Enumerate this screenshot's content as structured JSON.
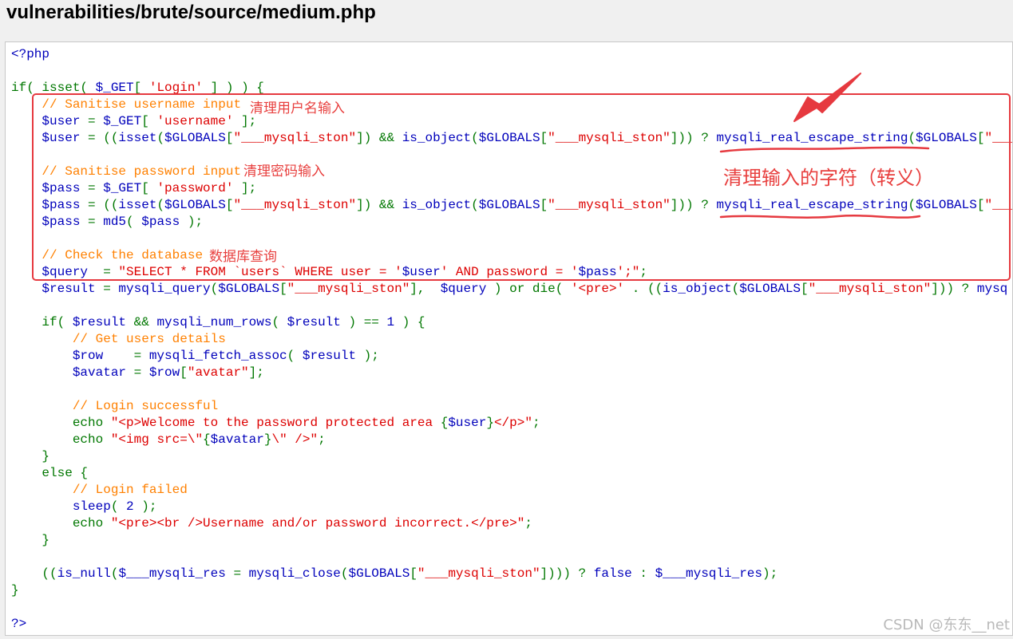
{
  "page": {
    "title": "vulnerabilities/brute/source/medium.php"
  },
  "code_lines": [
    [
      {
        "t": "<?php",
        "c": "v"
      }
    ],
    [],
    [
      {
        "t": "if( ",
        "c": "k"
      },
      {
        "t": "isset",
        "c": "k"
      },
      {
        "t": "( ",
        "c": "k"
      },
      {
        "t": "$_GET",
        "c": "v"
      },
      {
        "t": "[ ",
        "c": "k"
      },
      {
        "t": "'Login'",
        "c": "s"
      },
      {
        "t": " ] ) ) {",
        "c": "k"
      }
    ],
    [
      {
        "t": "    "
      },
      {
        "t": "// Sanitise username input",
        "c": "c"
      }
    ],
    [
      {
        "t": "    "
      },
      {
        "t": "$user ",
        "c": "v"
      },
      {
        "t": "= ",
        "c": "k"
      },
      {
        "t": "$_GET",
        "c": "v"
      },
      {
        "t": "[ ",
        "c": "k"
      },
      {
        "t": "'username'",
        "c": "s"
      },
      {
        "t": " ];",
        "c": "k"
      }
    ],
    [
      {
        "t": "    "
      },
      {
        "t": "$user ",
        "c": "v"
      },
      {
        "t": "= ((",
        "c": "k"
      },
      {
        "t": "isset",
        "c": "v"
      },
      {
        "t": "(",
        "c": "k"
      },
      {
        "t": "$GLOBALS",
        "c": "v"
      },
      {
        "t": "[",
        "c": "k"
      },
      {
        "t": "\"___mysqli_ston\"",
        "c": "s"
      },
      {
        "t": "]) && ",
        "c": "k"
      },
      {
        "t": "is_object",
        "c": "v"
      },
      {
        "t": "(",
        "c": "k"
      },
      {
        "t": "$GLOBALS",
        "c": "v"
      },
      {
        "t": "[",
        "c": "k"
      },
      {
        "t": "\"___mysqli_ston\"",
        "c": "s"
      },
      {
        "t": "])) ? ",
        "c": "k"
      },
      {
        "t": "mysqli_real_escape_string",
        "c": "v"
      },
      {
        "t": "(",
        "c": "k"
      },
      {
        "t": "$GLOBALS",
        "c": "v"
      },
      {
        "t": "[",
        "c": "k"
      },
      {
        "t": "\"___mysqli_ston\"",
        "c": "s"
      }
    ],
    [],
    [
      {
        "t": "    "
      },
      {
        "t": "// Sanitise password input",
        "c": "c"
      }
    ],
    [
      {
        "t": "    "
      },
      {
        "t": "$pass ",
        "c": "v"
      },
      {
        "t": "= ",
        "c": "k"
      },
      {
        "t": "$_GET",
        "c": "v"
      },
      {
        "t": "[ ",
        "c": "k"
      },
      {
        "t": "'password'",
        "c": "s"
      },
      {
        "t": " ];",
        "c": "k"
      }
    ],
    [
      {
        "t": "    "
      },
      {
        "t": "$pass ",
        "c": "v"
      },
      {
        "t": "= ((",
        "c": "k"
      },
      {
        "t": "isset",
        "c": "v"
      },
      {
        "t": "(",
        "c": "k"
      },
      {
        "t": "$GLOBALS",
        "c": "v"
      },
      {
        "t": "[",
        "c": "k"
      },
      {
        "t": "\"___mysqli_ston\"",
        "c": "s"
      },
      {
        "t": "]) && ",
        "c": "k"
      },
      {
        "t": "is_object",
        "c": "v"
      },
      {
        "t": "(",
        "c": "k"
      },
      {
        "t": "$GLOBALS",
        "c": "v"
      },
      {
        "t": "[",
        "c": "k"
      },
      {
        "t": "\"___mysqli_ston\"",
        "c": "s"
      },
      {
        "t": "])) ? ",
        "c": "k"
      },
      {
        "t": "mysqli_real_escape_string",
        "c": "v"
      },
      {
        "t": "(",
        "c": "k"
      },
      {
        "t": "$GLOBALS",
        "c": "v"
      },
      {
        "t": "[",
        "c": "k"
      },
      {
        "t": "\"___mysqli_ston\"",
        "c": "s"
      }
    ],
    [
      {
        "t": "    "
      },
      {
        "t": "$pass ",
        "c": "v"
      },
      {
        "t": "= ",
        "c": "k"
      },
      {
        "t": "md5",
        "c": "v"
      },
      {
        "t": "( ",
        "c": "k"
      },
      {
        "t": "$pass ",
        "c": "v"
      },
      {
        "t": ");",
        "c": "k"
      }
    ],
    [],
    [
      {
        "t": "    "
      },
      {
        "t": "// Check the database",
        "c": "c"
      }
    ],
    [
      {
        "t": "    "
      },
      {
        "t": "$query  ",
        "c": "v"
      },
      {
        "t": "= ",
        "c": "k"
      },
      {
        "t": "\"SELECT * FROM `users` WHERE user = '",
        "c": "s"
      },
      {
        "t": "$user",
        "c": "v"
      },
      {
        "t": "' AND password = '",
        "c": "s"
      },
      {
        "t": "$pass",
        "c": "v"
      },
      {
        "t": "';\"",
        "c": "s"
      },
      {
        "t": ";",
        "c": "k"
      }
    ],
    [
      {
        "t": "    "
      },
      {
        "t": "$result ",
        "c": "v"
      },
      {
        "t": "= ",
        "c": "k"
      },
      {
        "t": "mysqli_query",
        "c": "v"
      },
      {
        "t": "(",
        "c": "k"
      },
      {
        "t": "$GLOBALS",
        "c": "v"
      },
      {
        "t": "[",
        "c": "k"
      },
      {
        "t": "\"___mysqli_ston\"",
        "c": "s"
      },
      {
        "t": "],  ",
        "c": "k"
      },
      {
        "t": "$query ",
        "c": "v"
      },
      {
        "t": ") or die( ",
        "c": "k"
      },
      {
        "t": "'<pre>'",
        "c": "s"
      },
      {
        "t": " . ((",
        "c": "k"
      },
      {
        "t": "is_object",
        "c": "v"
      },
      {
        "t": "(",
        "c": "k"
      },
      {
        "t": "$GLOBALS",
        "c": "v"
      },
      {
        "t": "[",
        "c": "k"
      },
      {
        "t": "\"___mysqli_ston\"",
        "c": "s"
      },
      {
        "t": "])) ? ",
        "c": "k"
      },
      {
        "t": "mysq",
        "c": "v"
      }
    ],
    [],
    [
      {
        "t": "    "
      },
      {
        "t": "if( ",
        "c": "k"
      },
      {
        "t": "$result ",
        "c": "v"
      },
      {
        "t": "&& ",
        "c": "k"
      },
      {
        "t": "mysqli_num_rows",
        "c": "v"
      },
      {
        "t": "( ",
        "c": "k"
      },
      {
        "t": "$result ",
        "c": "v"
      },
      {
        "t": ") == ",
        "c": "k"
      },
      {
        "t": "1 ",
        "c": "v"
      },
      {
        "t": ") {",
        "c": "k"
      }
    ],
    [
      {
        "t": "        "
      },
      {
        "t": "// Get users details",
        "c": "c"
      }
    ],
    [
      {
        "t": "        "
      },
      {
        "t": "$row    ",
        "c": "v"
      },
      {
        "t": "= ",
        "c": "k"
      },
      {
        "t": "mysqli_fetch_assoc",
        "c": "v"
      },
      {
        "t": "( ",
        "c": "k"
      },
      {
        "t": "$result ",
        "c": "v"
      },
      {
        "t": ");",
        "c": "k"
      }
    ],
    [
      {
        "t": "        "
      },
      {
        "t": "$avatar ",
        "c": "v"
      },
      {
        "t": "= ",
        "c": "k"
      },
      {
        "t": "$row",
        "c": "v"
      },
      {
        "t": "[",
        "c": "k"
      },
      {
        "t": "\"avatar\"",
        "c": "s"
      },
      {
        "t": "];",
        "c": "k"
      }
    ],
    [],
    [
      {
        "t": "        "
      },
      {
        "t": "// Login successful",
        "c": "c"
      }
    ],
    [
      {
        "t": "        "
      },
      {
        "t": "echo ",
        "c": "k"
      },
      {
        "t": "\"<p>Welcome to the password protected area ",
        "c": "s"
      },
      {
        "t": "{",
        "c": "k"
      },
      {
        "t": "$user",
        "c": "v"
      },
      {
        "t": "}",
        "c": "k"
      },
      {
        "t": "</p>\"",
        "c": "s"
      },
      {
        "t": ";",
        "c": "k"
      }
    ],
    [
      {
        "t": "        "
      },
      {
        "t": "echo ",
        "c": "k"
      },
      {
        "t": "\"<img src=\\\"",
        "c": "s"
      },
      {
        "t": "{",
        "c": "k"
      },
      {
        "t": "$avatar",
        "c": "v"
      },
      {
        "t": "}",
        "c": "k"
      },
      {
        "t": "\\\" />\"",
        "c": "s"
      },
      {
        "t": ";",
        "c": "k"
      }
    ],
    [
      {
        "t": "    "
      },
      {
        "t": "}",
        "c": "k"
      }
    ],
    [
      {
        "t": "    "
      },
      {
        "t": "else {",
        "c": "k"
      }
    ],
    [
      {
        "t": "        "
      },
      {
        "t": "// Login failed",
        "c": "c"
      }
    ],
    [
      {
        "t": "        "
      },
      {
        "t": "sleep",
        "c": "v"
      },
      {
        "t": "( ",
        "c": "k"
      },
      {
        "t": "2 ",
        "c": "v"
      },
      {
        "t": ");",
        "c": "k"
      }
    ],
    [
      {
        "t": "        "
      },
      {
        "t": "echo ",
        "c": "k"
      },
      {
        "t": "\"<pre><br />Username and/or password incorrect.</pre>\"",
        "c": "s"
      },
      {
        "t": ";",
        "c": "k"
      }
    ],
    [
      {
        "t": "    "
      },
      {
        "t": "}",
        "c": "k"
      }
    ],
    [],
    [
      {
        "t": "    "
      },
      {
        "t": "((",
        "c": "k"
      },
      {
        "t": "is_null",
        "c": "v"
      },
      {
        "t": "(",
        "c": "k"
      },
      {
        "t": "$___mysqli_res ",
        "c": "v"
      },
      {
        "t": "= ",
        "c": "k"
      },
      {
        "t": "mysqli_close",
        "c": "v"
      },
      {
        "t": "(",
        "c": "k"
      },
      {
        "t": "$GLOBALS",
        "c": "v"
      },
      {
        "t": "[",
        "c": "k"
      },
      {
        "t": "\"___mysqli_ston\"",
        "c": "s"
      },
      {
        "t": "]))) ? ",
        "c": "k"
      },
      {
        "t": "false ",
        "c": "v"
      },
      {
        "t": ": ",
        "c": "k"
      },
      {
        "t": "$___mysqli_res",
        "c": "v"
      },
      {
        "t": ");",
        "c": "k"
      }
    ],
    [
      {
        "t": "}",
        "c": "k"
      }
    ],
    [],
    [
      {
        "t": "?>",
        "c": "v"
      }
    ]
  ],
  "annotations": {
    "username_note": "清理用户名输入",
    "password_note": "清理密码输入",
    "database_note": "数据库查询",
    "escape_note": "清理输入的字符（转义）"
  },
  "watermark": "CSDN @东东__net",
  "colors": {
    "annotation_red": "#e6393f",
    "php_variable": "#0000bb",
    "php_keyword": "#007700",
    "php_string": "#dd0000",
    "php_comment": "#ff8000"
  }
}
